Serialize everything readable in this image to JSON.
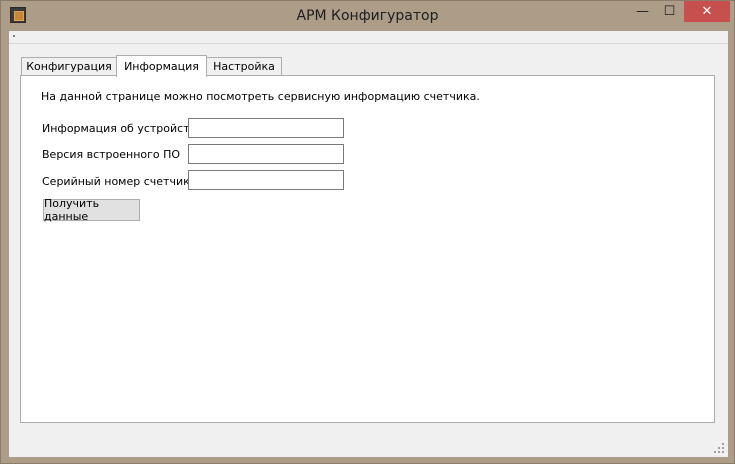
{
  "window": {
    "title": "АРМ Конфигуратор",
    "min_glyph": "—",
    "max_glyph": "☐",
    "close_glyph": "✕"
  },
  "tabs": [
    {
      "label": "Конфигурация",
      "active": false
    },
    {
      "label": "Информация",
      "active": true
    },
    {
      "label": "Настройка",
      "active": false
    }
  ],
  "info_page": {
    "description": "На данной странице можно посмотреть сервисную информацию счетчика.",
    "fields": [
      {
        "label": "Информация об устройстве",
        "value": ""
      },
      {
        "label": "Версия встроенного ПО",
        "value": ""
      },
      {
        "label": "Серийный номер счетчика",
        "value": ""
      }
    ],
    "get_data_button": "Получить данные"
  }
}
